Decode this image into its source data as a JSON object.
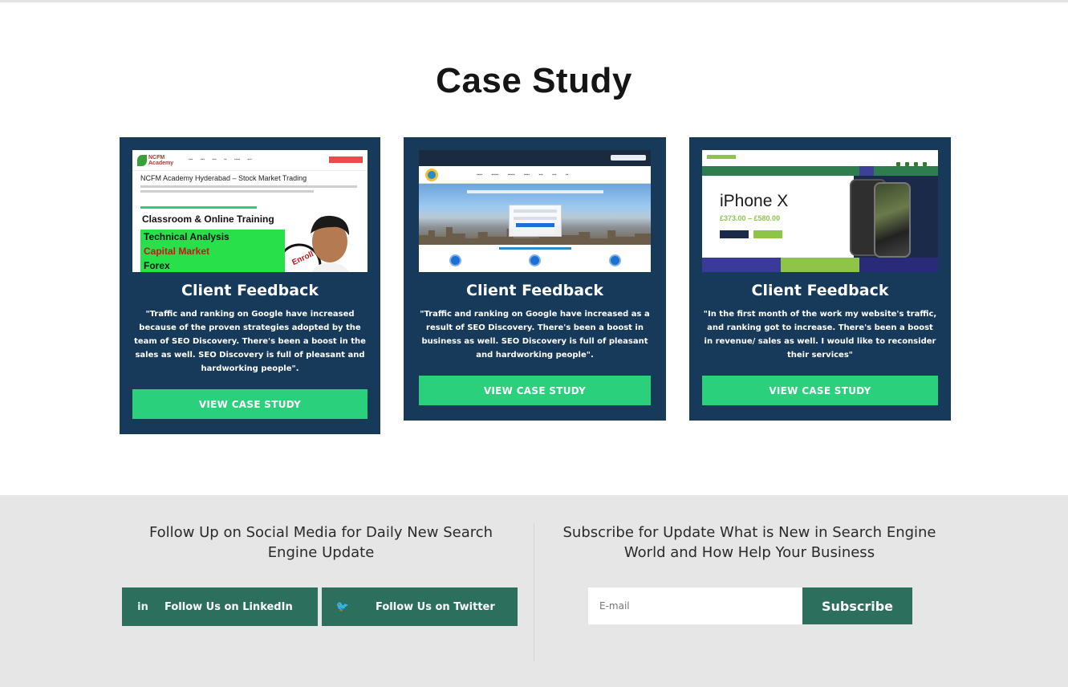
{
  "section": {
    "title": "Case Study"
  },
  "cards": [
    {
      "title": "Client Feedback",
      "quote": "\"Traffic and ranking on Google have increased because of the proven strategies adopted by the team of SEO Discovery. There's been a boost in the sales as well. SEO Discovery is full of pleasant and hardworking people\".",
      "button": "VIEW CASE STUDY",
      "screenshot": {
        "logo": "NCFM Academy",
        "heading": "NCFM Academy Hyderabad – Stock Market Trading",
        "banner": "Classroom & Online Training",
        "lines": [
          "Technical Analysis",
          "Capital Market",
          "Forex"
        ],
        "stamp": "Enroll Now"
      }
    },
    {
      "title": "Client Feedback",
      "quote": "\"Traffic and ranking on Google have increased as a result of SEO Discovery. There's been a boost in business as well. SEO Discovery is full of pleasant and hardworking people\".",
      "button": "VIEW CASE STUDY"
    },
    {
      "title": "Client Feedback",
      "quote": "\"In the first month of the work my website's traffic, and ranking got to increase. There's been a boost in revenue/ sales as well. I would like to reconsider their services\"",
      "button": "VIEW CASE STUDY",
      "screenshot": {
        "title": "iPhone X",
        "price": "£373.00 – £580.00"
      }
    }
  ],
  "footer": {
    "social_heading": "Follow Up on Social Media for Daily New Search Engine Update",
    "linkedin_label": "Follow Us on LinkedIn",
    "twitter_label": "Follow Us on Twitter",
    "linkedin_icon": "linkedin-icon",
    "twitter_icon": "twitter-icon",
    "subscribe_heading": "Subscribe for Update What is New in Search Engine World and How Help Your Business",
    "email_placeholder": "E-mail",
    "subscribe_label": "Subscribe"
  },
  "colors": {
    "card_bg": "#17395a",
    "button_green": "#2ad07b",
    "footer_bg": "#e6e6e6",
    "footer_button": "#2b6f5c"
  }
}
